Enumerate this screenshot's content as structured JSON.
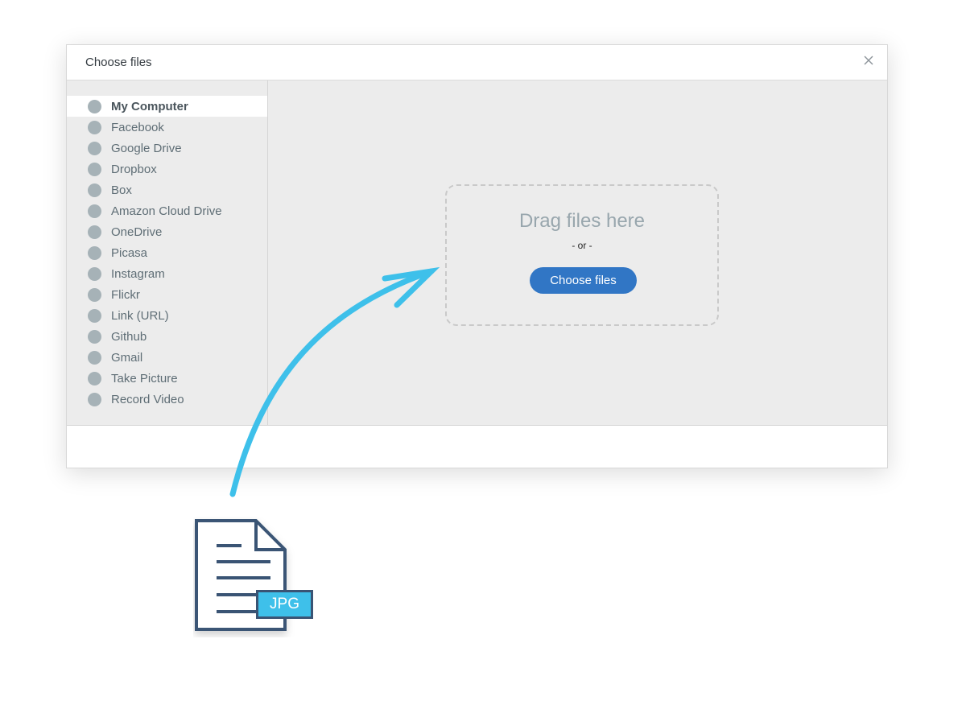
{
  "dialog": {
    "title": "Choose files",
    "close_icon": "close-icon"
  },
  "sidebar": {
    "items": [
      {
        "label": "My Computer",
        "active": true
      },
      {
        "label": "Facebook"
      },
      {
        "label": "Google Drive"
      },
      {
        "label": "Dropbox"
      },
      {
        "label": "Box"
      },
      {
        "label": "Amazon Cloud Drive"
      },
      {
        "label": "OneDrive"
      },
      {
        "label": "Picasa"
      },
      {
        "label": "Instagram"
      },
      {
        "label": "Flickr"
      },
      {
        "label": "Link (URL)"
      },
      {
        "label": "Github"
      },
      {
        "label": "Gmail"
      },
      {
        "label": "Take Picture"
      },
      {
        "label": "Record Video"
      }
    ]
  },
  "dropzone": {
    "heading": "Drag files here",
    "separator": "- or -",
    "button_label": "Choose files"
  },
  "illustration": {
    "file_badge": "JPG",
    "arrow_icon": "curved-arrow-icon",
    "file_icon": "document-icon"
  },
  "colors": {
    "accent_button": "#3176c5",
    "arrow": "#3ec0ea",
    "file_outline": "#3a5474",
    "sidebar_dot": "#a6b2b7",
    "pane_background": "#ececec"
  }
}
